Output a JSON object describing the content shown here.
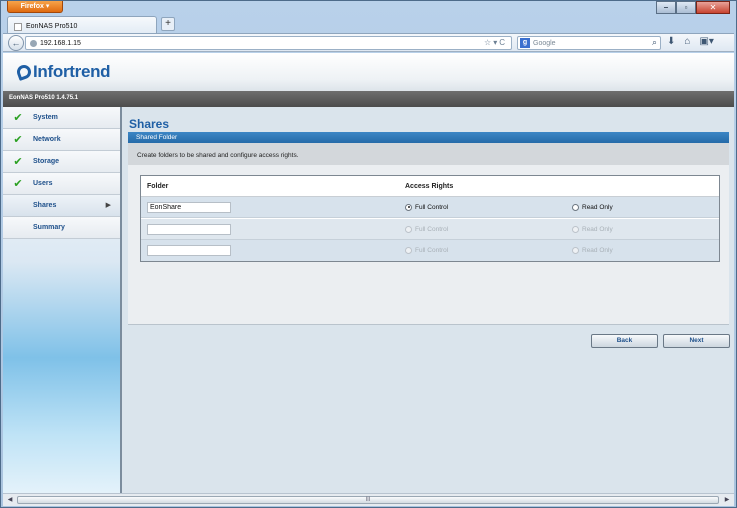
{
  "browser": {
    "menu_button": "Firefox",
    "tab_title": "EonNAS Pro510",
    "new_tab": "+",
    "url": "192.168.1.15",
    "search_placeholder": "Google",
    "window_controls": [
      "–",
      "▫",
      "✕"
    ]
  },
  "header": {
    "logo_text": "Infortrend",
    "version": "EonNAS Pro510 1.4.75.1"
  },
  "sidebar": {
    "items": [
      {
        "label": "System",
        "checked": true
      },
      {
        "label": "Network",
        "checked": true
      },
      {
        "label": "Storage",
        "checked": true
      },
      {
        "label": "Users",
        "checked": true
      },
      {
        "label": "Shares",
        "checked": false,
        "active": true
      },
      {
        "label": "Summary",
        "checked": false
      }
    ]
  },
  "main": {
    "title": "Shares",
    "section_title": "Shared Folder",
    "description": "Create folders to be shared and configure access rights.",
    "table": {
      "headers": {
        "folder": "Folder",
        "access": "Access Rights"
      },
      "rows": [
        {
          "folder": "EonShare",
          "full_control": "Full Control",
          "read_only": "Read Only",
          "selected": "full_control",
          "enabled": true
        },
        {
          "folder": "",
          "full_control": "Full Control",
          "read_only": "Read Only",
          "selected": "",
          "enabled": false
        },
        {
          "folder": "",
          "full_control": "Full Control",
          "read_only": "Read Only",
          "selected": "",
          "enabled": false
        }
      ]
    },
    "buttons": {
      "back": "Back",
      "next": "Next"
    }
  },
  "scrollbar": {
    "grip": "III"
  }
}
